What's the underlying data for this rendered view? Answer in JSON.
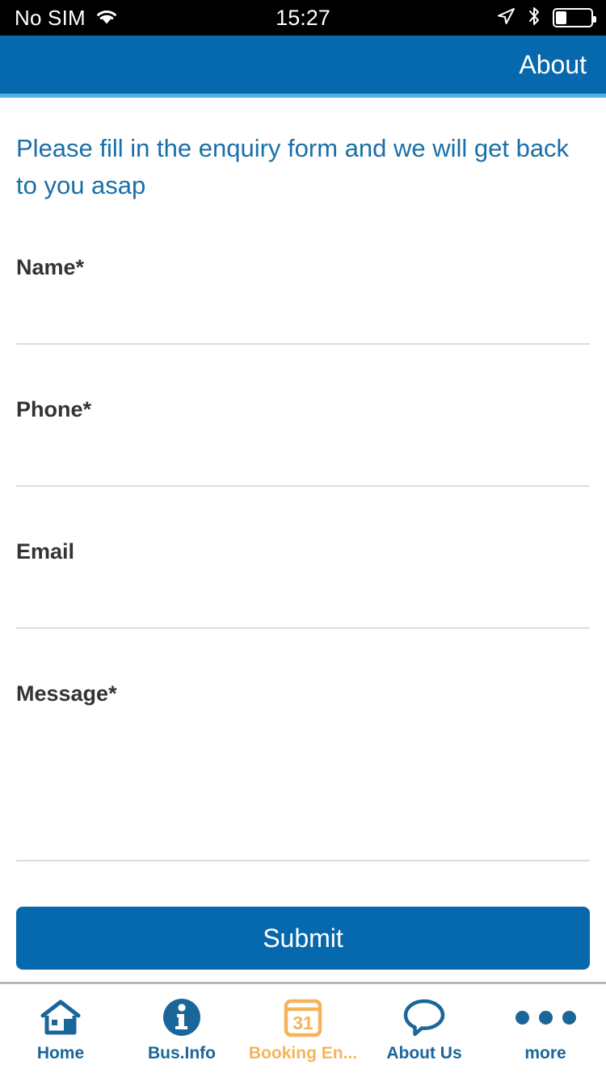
{
  "status_bar": {
    "carrier": "No SIM",
    "time": "15:27",
    "wifi_icon": "wifi-icon",
    "location_icon": "location-arrow-icon",
    "bluetooth_icon": "bluetooth-icon",
    "battery_icon": "battery-icon",
    "battery_level_percent": 28
  },
  "navbar": {
    "title": "About",
    "background_color": "#0769AD",
    "accent_color": "#4FB3E8"
  },
  "main": {
    "intro_text": "Please fill in the enquiry form and we will get back to you asap",
    "intro_color": "#1A6FA8",
    "fields": [
      {
        "label": "Name*",
        "value": "",
        "placeholder": "",
        "type": "text"
      },
      {
        "label": "Phone*",
        "value": "",
        "placeholder": "",
        "type": "tel"
      },
      {
        "label": "Email",
        "value": "",
        "placeholder": "",
        "type": "email"
      },
      {
        "label": "Message*",
        "value": "",
        "placeholder": "",
        "type": "textarea"
      }
    ],
    "submit_label": "Submit",
    "submit_color": "#0769AD"
  },
  "tabbar": {
    "active_color": "#F5B45C",
    "inactive_color": "#1A6699",
    "items": [
      {
        "label": "Home",
        "icon": "house-icon",
        "active": false
      },
      {
        "label": "Bus.Info",
        "icon": "info-circle-icon",
        "active": false
      },
      {
        "label": "Booking En...",
        "icon": "calendar-31-icon",
        "active": true
      },
      {
        "label": "About Us",
        "icon": "speech-bubble-icon",
        "active": false
      },
      {
        "label": "more",
        "icon": "ellipsis-icon",
        "active": false
      }
    ]
  }
}
